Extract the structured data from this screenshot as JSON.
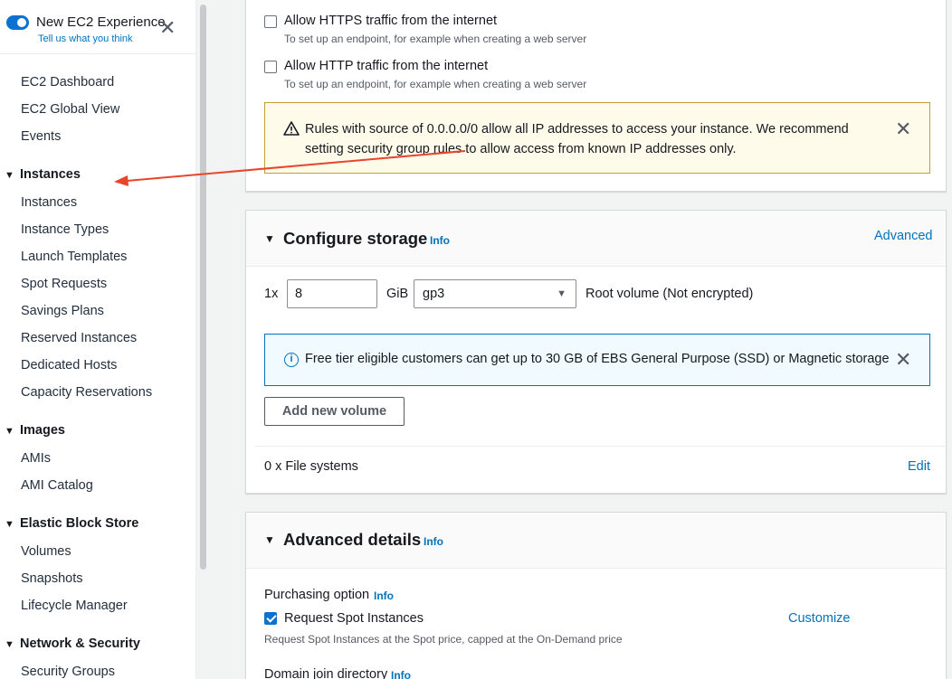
{
  "sidebar": {
    "experience_title": "New EC2 Experience",
    "experience_link": "Tell us what you think",
    "close_glyph": "✕",
    "top_links": [
      "EC2 Dashboard",
      "EC2 Global View",
      "Events"
    ],
    "sections": [
      {
        "title": "Instances",
        "items": [
          "Instances",
          "Instance Types",
          "Launch Templates",
          "Spot Requests",
          "Savings Plans",
          "Reserved Instances",
          "Dedicated Hosts",
          "Capacity Reservations"
        ]
      },
      {
        "title": "Images",
        "items": [
          "AMIs",
          "AMI Catalog"
        ]
      },
      {
        "title": "Elastic Block Store",
        "items": [
          "Volumes",
          "Snapshots",
          "Lifecycle Manager"
        ]
      },
      {
        "title": "Network & Security",
        "items": [
          "Security Groups"
        ]
      }
    ]
  },
  "network": {
    "https_label": "Allow HTTPS traffic from the internet",
    "https_desc": "To set up an endpoint, for example when creating a web server",
    "http_label": "Allow HTTP traffic from the internet",
    "http_desc": "To set up an endpoint, for example when creating a web server",
    "warning_text": "Rules with source of 0.0.0.0/0 allow all IP addresses to access your instance. We recommend setting security group rules to allow access from known IP addresses only."
  },
  "storage": {
    "title": "Configure storage",
    "info": "Info",
    "advanced_link": "Advanced",
    "count_label": "1x",
    "size_value": "8",
    "unit_label": "GiB",
    "volume_type": "gp3",
    "root_label": "Root volume  (Not encrypted)",
    "free_tier_text": "Free tier eligible customers can get up to 30 GB of EBS General Purpose (SSD) or Magnetic storage",
    "add_volume_button": "Add new volume",
    "file_systems_label": "0 x File systems",
    "edit_link": "Edit"
  },
  "advanced": {
    "title": "Advanced details",
    "info": "Info",
    "purchasing_label": "Purchasing option",
    "purchasing_info": "Info",
    "spot_label": "Request Spot Instances",
    "spot_checked": true,
    "customize_link": "Customize",
    "spot_desc": "Request Spot Instances at the Spot price, capped at the On-Demand price",
    "domain_label": "Domain join directory",
    "domain_info": "Info"
  },
  "colors": {
    "link": "#0073bb",
    "toggle": "#0972d3",
    "warning_bg": "#fffbeb",
    "warning_border": "#c29d3a",
    "info_bg": "#f1faff",
    "annotation_arrow": "#e8452c"
  }
}
